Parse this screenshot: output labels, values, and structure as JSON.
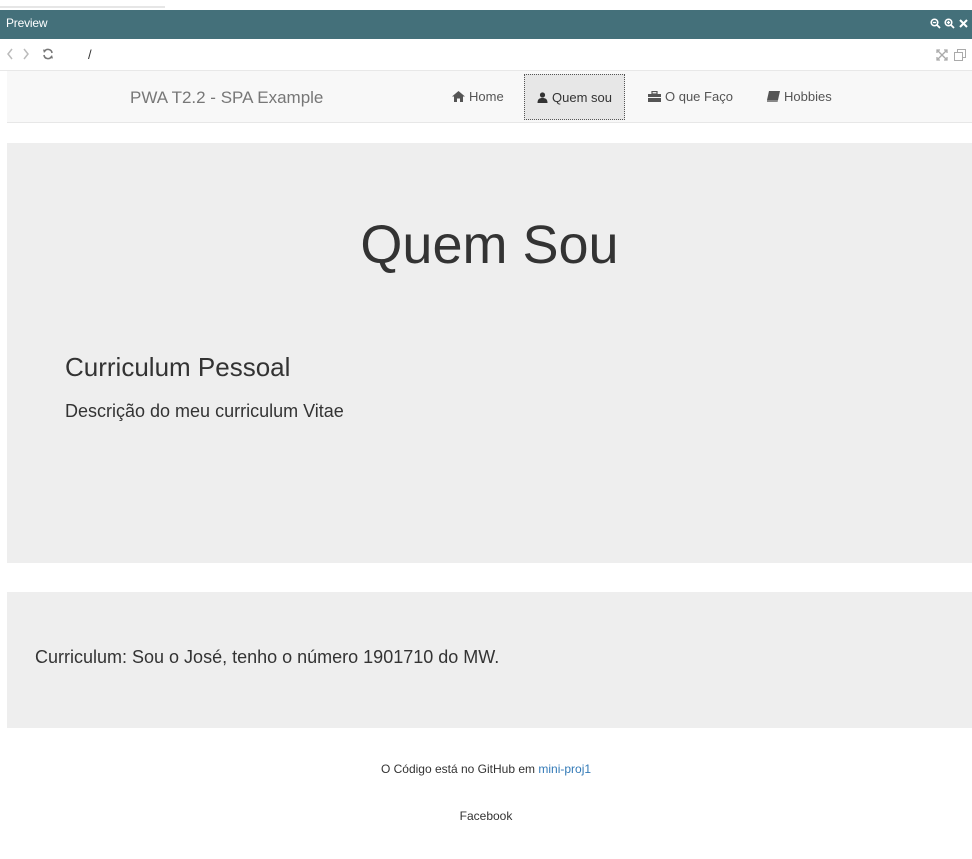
{
  "preview": {
    "title": "Preview"
  },
  "address": {
    "path": "/"
  },
  "navbar": {
    "brand": "PWA T2.2 - SPA Example",
    "items": [
      {
        "label": "Home",
        "icon": "home-icon"
      },
      {
        "label": "Quem sou",
        "icon": "user-icon"
      },
      {
        "label": "O que Faço",
        "icon": "briefcase-icon"
      },
      {
        "label": "Hobbies",
        "icon": "book-icon"
      }
    ]
  },
  "jumbotron": {
    "title": "Quem Sou",
    "subtitle": "Curriculum Pessoal",
    "description": "Descrição do meu curriculum Vitae"
  },
  "well": {
    "text": "Curriculum: Sou o José, tenho o número 1901710 do MW."
  },
  "footer": {
    "text": "O Código está no GitHub em",
    "link": "mini-proj1",
    "facebook": "Facebook"
  },
  "colors": {
    "preview_bar": "#44707a",
    "link": "#337ab7"
  }
}
